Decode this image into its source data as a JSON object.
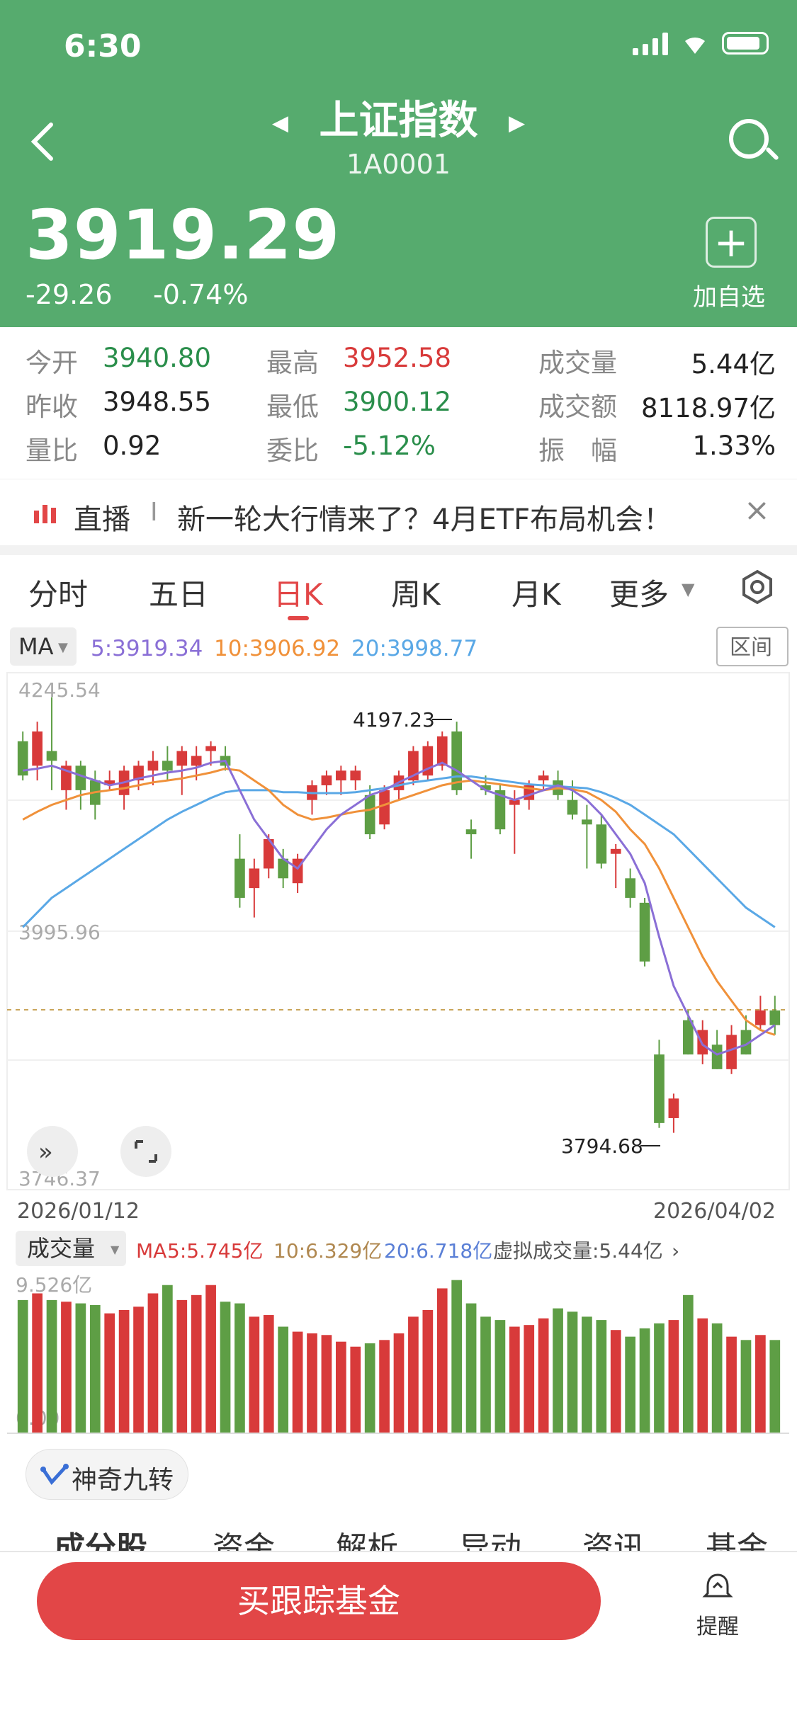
{
  "status": {
    "time": "6:30"
  },
  "header": {
    "title": "上证指数",
    "code": "1A0001",
    "price": "3919.29",
    "change": "-29.26",
    "change_pct": "-0.74%",
    "add_label": "加自选",
    "add_symbol": "+",
    "bg_color": "#56ab6e"
  },
  "stats": [
    {
      "label": "今开",
      "value": "3940.80",
      "color": "green"
    },
    {
      "label": "最高",
      "value": "3952.58",
      "color": "red"
    },
    {
      "label": "成交量",
      "value": "5.44亿",
      "color": "dark"
    },
    {
      "label": "昨收",
      "value": "3948.55",
      "color": "dark"
    },
    {
      "label": "最低",
      "value": "3900.12",
      "color": "green"
    },
    {
      "label": "成交额",
      "value": "8118.97亿",
      "color": "dark"
    },
    {
      "label": "量比",
      "value": "0.92",
      "color": "dark"
    },
    {
      "label": "委比",
      "value": "-5.12%",
      "color": "green"
    },
    {
      "label": "振　幅",
      "value": "1.33%",
      "color": "dark"
    }
  ],
  "ad": {
    "tag": "直播",
    "sep": "I",
    "text": "新一轮大行情来了？4月ETF布局机会！"
  },
  "tabs": [
    "分时",
    "五日",
    "日K",
    "周K",
    "月K",
    "更多"
  ],
  "active_tab": "日K",
  "ma_bar": {
    "label": "MA",
    "ma5": "5:3919.34",
    "ma10": "10:3906.92",
    "ma20": "20:3998.77",
    "range_btn": "区间"
  },
  "price_axis": {
    "top": "4245.54",
    "mid": "3995.96",
    "bottom": "3746.37"
  },
  "annotations": {
    "high": "4197.23",
    "low": "3794.68"
  },
  "date_axis": {
    "start": "2026/01/12",
    "end": "2026/04/02"
  },
  "volume_bar": {
    "label": "成交量",
    "ma": "MA",
    "ma5": "5:5.745亿",
    "ma10": "10:6.329亿",
    "ma20": "20:6.718亿",
    "virtual": "虚拟成交量:5.44亿"
  },
  "volume_axis": {
    "top": "9.526亿",
    "bottom": "0.000"
  },
  "nine_turn_btn": "神奇九转",
  "bottom_tabs": [
    "成分股",
    "资金",
    "解析",
    "异动",
    "资讯",
    "基金"
  ],
  "buy_button": "买跟踪基金",
  "remind_label": "提醒",
  "colors": {
    "up": "#d83a3a",
    "down": "#5e9e45",
    "ma5": "#8a6fd6",
    "ma10": "#f0913a",
    "ma20": "#5aa8e6"
  },
  "chart_data": {
    "type": "candlestick",
    "ylim": [
      3746.37,
      4245.54
    ],
    "candles": [
      {
        "o": 4190,
        "h": 4200,
        "l": 4150,
        "c": 4155
      },
      {
        "o": 4165,
        "h": 4210,
        "l": 4150,
        "c": 4200
      },
      {
        "o": 4180,
        "h": 4235,
        "l": 4140,
        "c": 4170
      },
      {
        "o": 4140,
        "h": 4170,
        "l": 4120,
        "c": 4165
      },
      {
        "o": 4165,
        "h": 4170,
        "l": 4120,
        "c": 4140
      },
      {
        "o": 4150,
        "h": 4160,
        "l": 4110,
        "c": 4125
      },
      {
        "o": 4145,
        "h": 4160,
        "l": 4140,
        "c": 4150
      },
      {
        "o": 4135,
        "h": 4165,
        "l": 4120,
        "c": 4160
      },
      {
        "o": 4150,
        "h": 4170,
        "l": 4140,
        "c": 4165
      },
      {
        "o": 4160,
        "h": 4180,
        "l": 4145,
        "c": 4170
      },
      {
        "o": 4170,
        "h": 4185,
        "l": 4150,
        "c": 4160
      },
      {
        "o": 4165,
        "h": 4185,
        "l": 4135,
        "c": 4180
      },
      {
        "o": 4165,
        "h": 4185,
        "l": 4150,
        "c": 4175
      },
      {
        "o": 4180,
        "h": 4190,
        "l": 4165,
        "c": 4185
      },
      {
        "o": 4175,
        "h": 4185,
        "l": 4160,
        "c": 4165
      },
      {
        "o": 4070,
        "h": 4095,
        "l": 4020,
        "c": 4030
      },
      {
        "o": 4040,
        "h": 4070,
        "l": 4010,
        "c": 4060
      },
      {
        "o": 4060,
        "h": 4095,
        "l": 4050,
        "c": 4090
      },
      {
        "o": 4070,
        "h": 4080,
        "l": 4040,
        "c": 4050
      },
      {
        "o": 4045,
        "h": 4075,
        "l": 4035,
        "c": 4070
      },
      {
        "o": 4130,
        "h": 4150,
        "l": 4115,
        "c": 4145
      },
      {
        "o": 4145,
        "h": 4160,
        "l": 4135,
        "c": 4155
      },
      {
        "o": 4150,
        "h": 4165,
        "l": 4135,
        "c": 4160
      },
      {
        "o": 4150,
        "h": 4165,
        "l": 4140,
        "c": 4160
      },
      {
        "o": 4135,
        "h": 4145,
        "l": 4090,
        "c": 4095
      },
      {
        "o": 4105,
        "h": 4145,
        "l": 4100,
        "c": 4140
      },
      {
        "o": 4140,
        "h": 4160,
        "l": 4130,
        "c": 4155
      },
      {
        "o": 4150,
        "h": 4185,
        "l": 4145,
        "c": 4180
      },
      {
        "o": 4155,
        "h": 4190,
        "l": 4150,
        "c": 4185
      },
      {
        "o": 4165,
        "h": 4200,
        "l": 4160,
        "c": 4195
      },
      {
        "o": 4200,
        "h": 4210,
        "l": 4135,
        "c": 4140
      },
      {
        "o": 4100,
        "h": 4110,
        "l": 4070,
        "c": 4095
      },
      {
        "o": 4145,
        "h": 4155,
        "l": 4135,
        "c": 4140
      },
      {
        "o": 4140,
        "h": 4145,
        "l": 4095,
        "c": 4100
      },
      {
        "o": 4125,
        "h": 4140,
        "l": 4075,
        "c": 4130
      },
      {
        "o": 4130,
        "h": 4150,
        "l": 4120,
        "c": 4145
      },
      {
        "o": 4150,
        "h": 4160,
        "l": 4140,
        "c": 4155
      },
      {
        "o": 4150,
        "h": 4160,
        "l": 4130,
        "c": 4135
      },
      {
        "o": 4130,
        "h": 4150,
        "l": 4110,
        "c": 4115
      },
      {
        "o": 4110,
        "h": 4125,
        "l": 4060,
        "c": 4105
      },
      {
        "o": 4105,
        "h": 4115,
        "l": 4060,
        "c": 4065
      },
      {
        "o": 4075,
        "h": 4085,
        "l": 4040,
        "c": 4080
      },
      {
        "o": 4050,
        "h": 4060,
        "l": 4020,
        "c": 4030
      },
      {
        "o": 4025,
        "h": 4030,
        "l": 3960,
        "c": 3965
      },
      {
        "o": 3870,
        "h": 3885,
        "l": 3795,
        "c": 3800
      },
      {
        "o": 3805,
        "h": 3830,
        "l": 3790,
        "c": 3825
      },
      {
        "o": 3905,
        "h": 3915,
        "l": 3870,
        "c": 3870
      },
      {
        "o": 3870,
        "h": 3905,
        "l": 3860,
        "c": 3895
      },
      {
        "o": 3880,
        "h": 3895,
        "l": 3855,
        "c": 3855
      },
      {
        "o": 3855,
        "h": 3900,
        "l": 3850,
        "c": 3890
      },
      {
        "o": 3895,
        "h": 3910,
        "l": 3870,
        "c": 3870
      },
      {
        "o": 3900,
        "h": 3930,
        "l": 3895,
        "c": 3915
      },
      {
        "o": 3915,
        "h": 3930,
        "l": 3890,
        "c": 3900
      }
    ],
    "ma5": [
      4160,
      4162,
      4165,
      4160,
      4155,
      4150,
      4145,
      4148,
      4152,
      4155,
      4158,
      4160,
      4163,
      4168,
      4170,
      4140,
      4110,
      4090,
      4070,
      4060,
      4080,
      4100,
      4115,
      4125,
      4135,
      4140,
      4148,
      4155,
      4162,
      4168,
      4160,
      4150,
      4140,
      4135,
      4130,
      4135,
      4140,
      4145,
      4140,
      4130,
      4115,
      4095,
      4075,
      4045,
      3990,
      3940,
      3910,
      3880,
      3870,
      3875,
      3880,
      3890,
      3900
    ],
    "ma10": [
      4110,
      4118,
      4125,
      4130,
      4135,
      4138,
      4140,
      4142,
      4145,
      4148,
      4150,
      4152,
      4155,
      4158,
      4162,
      4160,
      4150,
      4140,
      4125,
      4115,
      4110,
      4112,
      4115,
      4118,
      4120,
      4125,
      4130,
      4135,
      4140,
      4145,
      4148,
      4150,
      4148,
      4146,
      4144,
      4142,
      4140,
      4142,
      4141,
      4138,
      4130,
      4118,
      4100,
      4085,
      4060,
      4030,
      4000,
      3970,
      3945,
      3925,
      3905,
      3895,
      3890
    ],
    "ma20": [
      4000,
      4015,
      4030,
      4040,
      4050,
      4060,
      4070,
      4080,
      4090,
      4100,
      4110,
      4118,
      4125,
      4132,
      4138,
      4140,
      4140,
      4140,
      4138,
      4138,
      4137,
      4137,
      4137,
      4138,
      4140,
      4142,
      4145,
      4148,
      4150,
      4152,
      4154,
      4154,
      4152,
      4150,
      4148,
      4146,
      4145,
      4144,
      4143,
      4142,
      4138,
      4132,
      4125,
      4115,
      4105,
      4095,
      4080,
      4065,
      4050,
      4035,
      4020,
      4010,
      4000
    ],
    "volumes": [
      8.0,
      8.4,
      8.0,
      7.9,
      7.8,
      7.7,
      7.2,
      7.4,
      7.6,
      8.4,
      8.9,
      8.0,
      8.3,
      8.9,
      7.9,
      7.8,
      7.0,
      7.1,
      6.4,
      6.1,
      6.0,
      5.9,
      5.5,
      5.2,
      5.4,
      5.6,
      6.0,
      7.0,
      7.4,
      8.7,
      9.2,
      7.8,
      7.0,
      6.8,
      6.4,
      6.5,
      6.9,
      7.5,
      7.3,
      7.0,
      6.8,
      6.2,
      5.8,
      6.3,
      6.6,
      6.8,
      8.3,
      6.9,
      6.6,
      5.8,
      5.6,
      5.9,
      5.6
    ]
  }
}
